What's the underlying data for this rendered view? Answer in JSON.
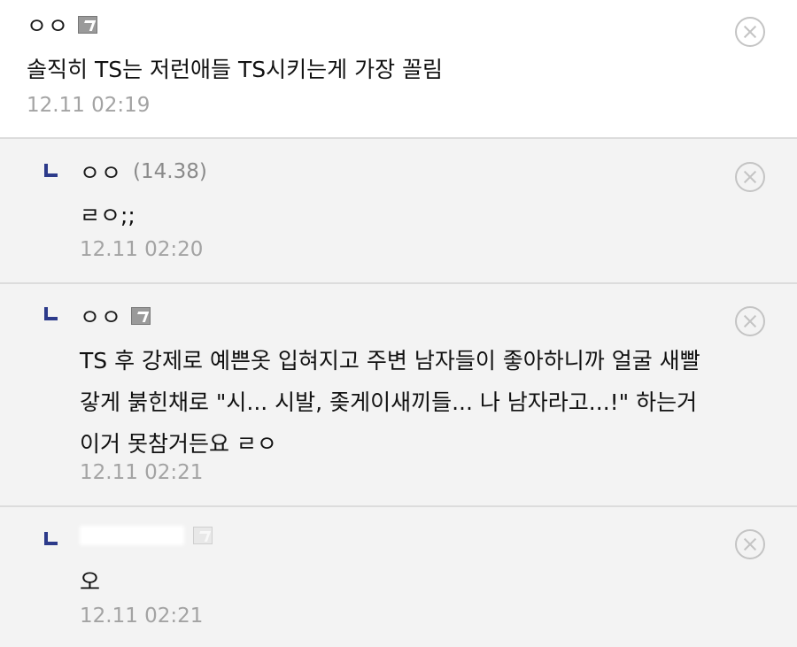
{
  "comments": [
    {
      "author": "ㅇㅇ",
      "body_lines": [
        "솔직히 TS는 저런애들 TS시키는게 가장 꼴림"
      ],
      "date": "12.11 02:19",
      "icon": "gallog-icon"
    },
    {
      "author": "ㅇㅇ",
      "ip": "(14.38)",
      "body_lines": [
        "ㄹㅇ;;"
      ],
      "date": "12.11 02:20",
      "reply_icon": "reply-arrow-icon"
    },
    {
      "author": "ㅇㅇ",
      "body_lines": [
        "TS 후 강제로 예쁜옷 입혀지고 주변 남자들이 좋아하니까 얼굴 새빨",
        "갛게 붉힌채로 \"시... 시발, 좆게이새끼들... 나 남자라고...!\" 하는거",
        "이거 못참거든요 ㄹㅇ"
      ],
      "date": "12.11 02:21",
      "icon": "gallog-icon",
      "reply_icon": "reply-arrow-icon"
    },
    {
      "author": "",
      "body_lines": [
        "오"
      ],
      "date": "12.11 02:21",
      "icon": "gallog-icon",
      "reply_icon": "reply-arrow-icon"
    }
  ],
  "colors": {
    "reply_background": "#f3f3f3",
    "reply_marker": "#2c3a8a",
    "date_text": "#a3a3a3",
    "divider": "#dcdcdc"
  },
  "delete_icon": "close-circle-icon"
}
